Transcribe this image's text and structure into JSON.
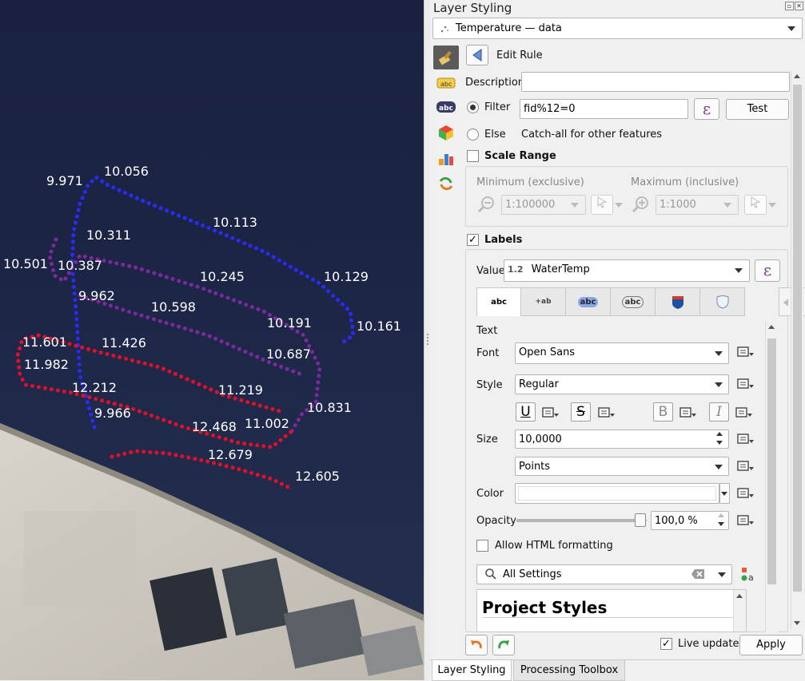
{
  "map": {
    "labels": {
      "l1": "9.971",
      "l2": "10.056",
      "l3": "10.113",
      "l4": "10.311",
      "l5": "10.501",
      "l6": "10.387",
      "l7": "10.245",
      "l8": "10.129",
      "l9": "9.962",
      "l10": "10.598",
      "l11": "10.191",
      "l12": "10.161",
      "l13": "11.601",
      "l14": "11.426",
      "l15": "10.687",
      "l16": "11.982",
      "l17": "12.212",
      "l18": "11.219",
      "l19": "9.966",
      "l20": "10.831",
      "l21": "12.468",
      "l22": "11.002",
      "l23": "12.679",
      "l24": "12.605"
    }
  },
  "panel": {
    "title": "Layer Styling",
    "layer_name": "Temperature — data",
    "edit_rule": "Edit Rule",
    "description_label": "Description",
    "description_value": "",
    "filter_label": "Filter",
    "filter_value": "fid%12=0",
    "expr_symbol": "ε",
    "test_button": "Test",
    "else_label": "Else",
    "else_desc": "Catch-all for other features",
    "scale_range_label": "Scale Range",
    "min_label": "Minimum (exclusive)",
    "max_label": "Maximum (inclusive)",
    "min_value": "1:100000",
    "max_value": "1:1000",
    "labels_label": "Labels",
    "labels_checked": "✓",
    "value_label": "Value",
    "value_type": "1.2",
    "value_field": "WaterTemp",
    "tabs": [
      "abc",
      "+ab",
      "abc",
      "abc",
      "",
      ""
    ],
    "text_section": "Text",
    "font_label": "Font",
    "font_value": "Open Sans",
    "style_label": "Style",
    "style_value": "Regular",
    "underline": "U",
    "strike": "S",
    "bold": "B",
    "italic": "I",
    "size_label": "Size",
    "size_value": "10,0000",
    "units_value": "Points",
    "color_label": "Color",
    "opacity_label": "Opacity",
    "opacity_value": "100,0 %",
    "opacity_percent": 100,
    "html_label": "Allow HTML formatting",
    "search_placeholder": "All Settings",
    "project_styles": "Project Styles",
    "live_update": "Live update",
    "live_checked": "✓",
    "apply_button": "Apply",
    "tab_layer_styling": "Layer Styling",
    "tab_processing": "Processing Toolbox"
  }
}
